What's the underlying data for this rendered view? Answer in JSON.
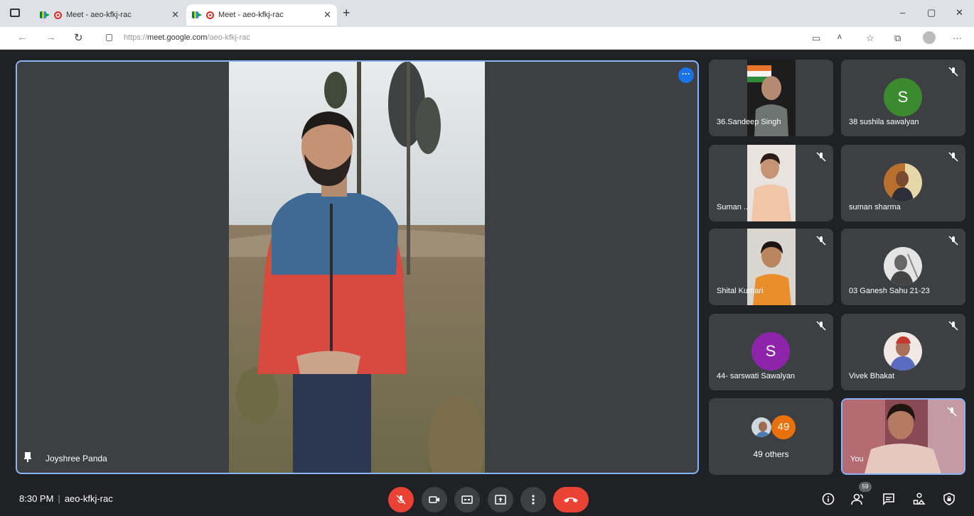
{
  "browser": {
    "tabs": [
      {
        "title": "Meet - aeo-kfkj-rac",
        "active": false
      },
      {
        "title": "Meet - aeo-kfkj-rac",
        "active": true
      }
    ],
    "url_prefix": "https://",
    "url_domain": "meet.google.com",
    "url_path": "/aeo-kfkj-rac",
    "new_tab": "+",
    "window": {
      "minimize": "–",
      "maximize": "▢",
      "close": "✕"
    }
  },
  "meet": {
    "main_speaker": {
      "name": "Joyshree Panda"
    },
    "participants": [
      {
        "name": "36.Sandeep Singh",
        "type": "video"
      },
      {
        "name": "38 sushila sawalyan",
        "type": "letter",
        "letter": "S",
        "color": "#3c8a2e"
      },
      {
        "name": "Suman ...",
        "type": "video"
      },
      {
        "name": "suman sharma",
        "type": "photo"
      },
      {
        "name": "Shital Kumari",
        "type": "video"
      },
      {
        "name": "03 Ganesh Sahu 21-23",
        "type": "photo"
      },
      {
        "name": "44- sarswati Sawalyan",
        "type": "letter",
        "letter": "S",
        "color": "#8e24aa"
      },
      {
        "name": "Vivek Bhakat",
        "type": "photo"
      },
      {
        "name": "You",
        "type": "self-video"
      }
    ],
    "others": {
      "count": "49",
      "label": "49 others"
    },
    "meeting_info": {
      "time": "8:30 PM",
      "code": "aeo-kfkj-rac"
    },
    "people_badge": "59",
    "colors": {
      "accent": "#8ab4f8",
      "end_call": "#ea4335",
      "tile_bg": "#3c4043",
      "bg": "#202124"
    }
  }
}
